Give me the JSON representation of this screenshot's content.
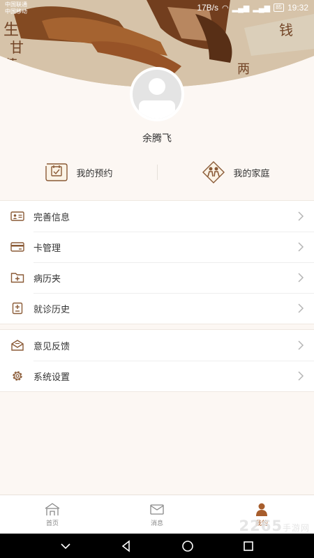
{
  "status_bar": {
    "carrier_1": "中国联通",
    "carrier_2": "中国移动",
    "net_speed": "17B/s",
    "battery": "85",
    "time": "19:32"
  },
  "profile": {
    "username": "余腾飞"
  },
  "quick_actions": [
    {
      "label": "我的预约",
      "icon": "calendar-scroll-icon"
    },
    {
      "label": "我的家庭",
      "icon": "family-icon"
    }
  ],
  "menu_group_1": [
    {
      "label": "完善信息",
      "icon": "id-card-icon"
    },
    {
      "label": "卡管理",
      "icon": "card-icon"
    },
    {
      "label": "病历夹",
      "icon": "medical-folder-icon"
    },
    {
      "label": "就诊历史",
      "icon": "history-record-icon"
    }
  ],
  "menu_group_2": [
    {
      "label": "意见反馈",
      "icon": "feedback-icon"
    },
    {
      "label": "系统设置",
      "icon": "gear-icon"
    }
  ],
  "tabs": [
    {
      "label": "首页",
      "icon": "home-icon",
      "active": false
    },
    {
      "label": "消息",
      "icon": "message-icon",
      "active": false
    },
    {
      "label": "我的",
      "icon": "person-icon",
      "active": true
    }
  ],
  "watermark": {
    "text": "2265",
    "suffix": "手游网"
  },
  "colors": {
    "accent": "#a75d2c",
    "background": "#fcf7f3",
    "icon_brown": "#8a5a36"
  }
}
